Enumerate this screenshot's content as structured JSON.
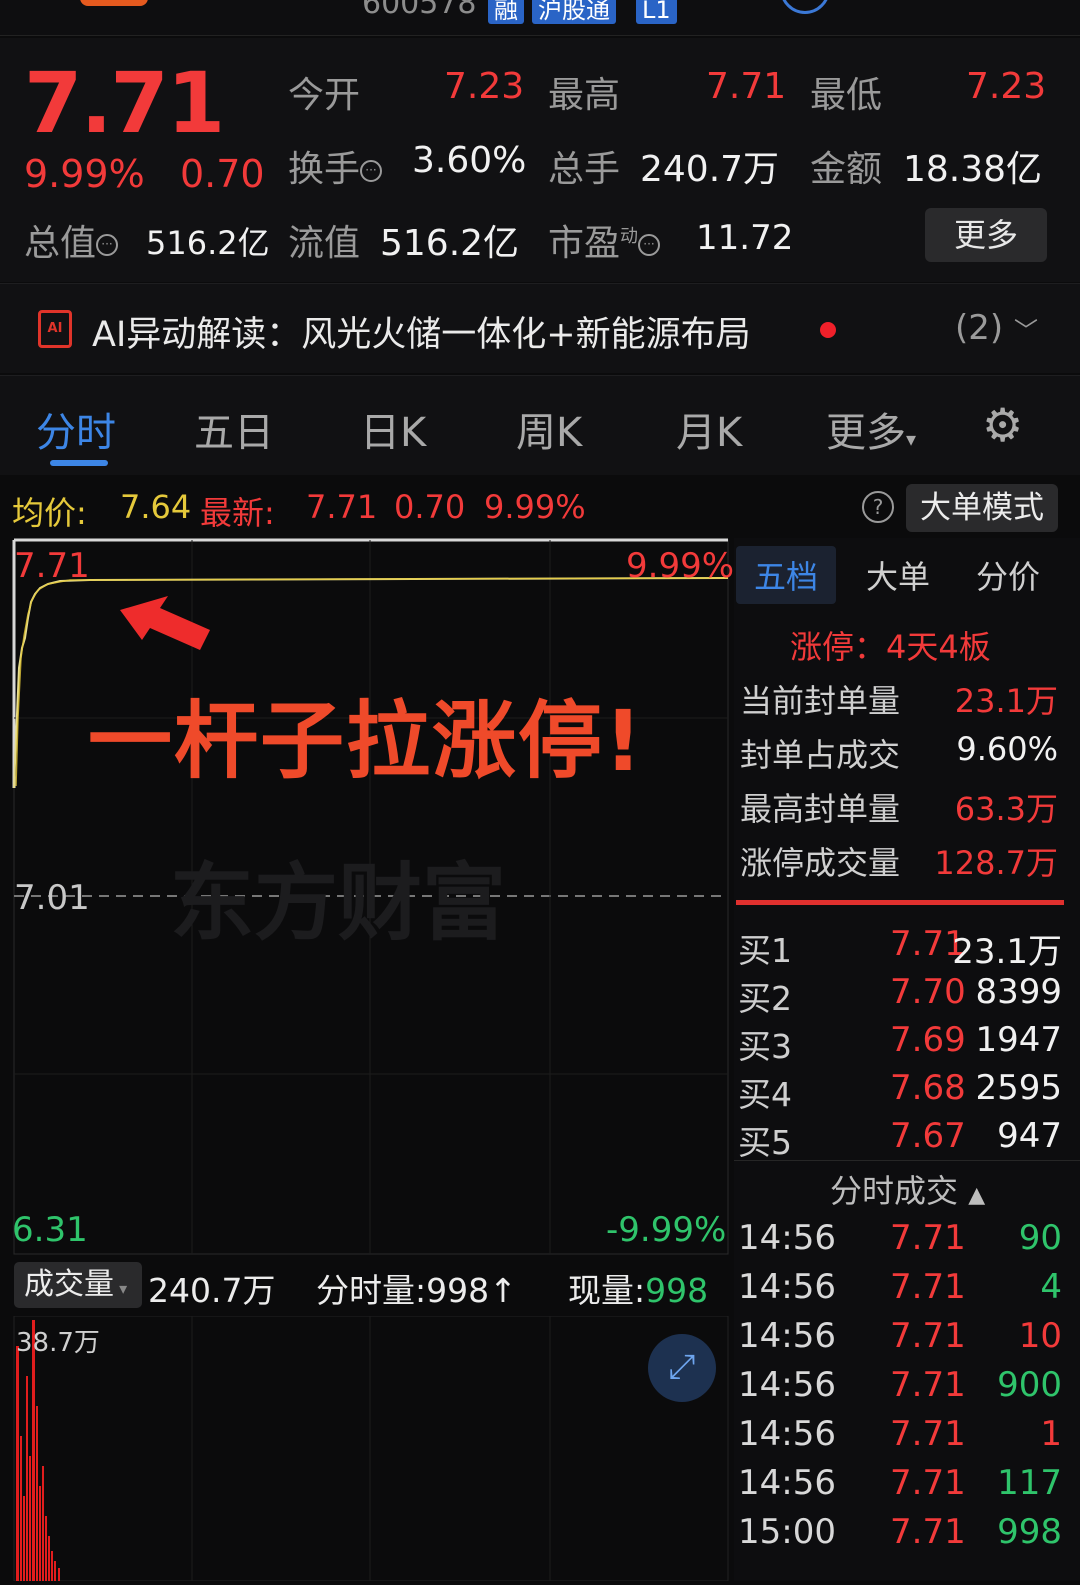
{
  "topbar": {
    "code": "600578",
    "tags": [
      "融",
      "沪股通",
      "L1"
    ]
  },
  "quote": {
    "price": "7.71",
    "change_pct": "9.99%",
    "change": "0.70",
    "open_label": "今开",
    "open": "7.23",
    "high_label": "最高",
    "high": "7.71",
    "low_label": "最低",
    "low": "7.23",
    "turnover_label": "换手",
    "turnover": "3.60%",
    "volume_label": "总手",
    "volume": "240.7万",
    "amount_label": "金额",
    "amount": "18.38亿",
    "mktcap_label": "总值",
    "mktcap": "516.2亿",
    "float_label": "流值",
    "float": "516.2亿",
    "pe_label": "市盈",
    "pe_sup": "动",
    "pe": "11.72",
    "more_label": "更多"
  },
  "ai": {
    "text": "AI异动解读：风光火储一体化+新能源布局",
    "count": "(2)"
  },
  "tabs": [
    "分时",
    "五日",
    "日K",
    "周K",
    "月K",
    "更多"
  ],
  "avgbar": {
    "avg_label": "均价:",
    "avg": "7.64",
    "latest_label": "最新:",
    "latest": "7.71",
    "chg": "0.70",
    "pct": "9.99%",
    "mode_label": "大单模式"
  },
  "chart": {
    "top_price": "7.71",
    "top_pct": "9.99%",
    "mid_price": "7.01",
    "bottom_price": "6.31",
    "bottom_pct": "-9.99%",
    "annotation": "一杆子拉涨停!",
    "watermark": "东方财富",
    "colors": {
      "price_line": "#e6dc8c",
      "up": "#f23a3a",
      "down": "#2fc46b",
      "avg": "#e5c93b"
    }
  },
  "volume": {
    "label": "成交量",
    "total": "240.7万",
    "minute_label": "分时量:",
    "minute": "998",
    "current_label": "现量:",
    "current": "998",
    "max": "38.7万"
  },
  "side": {
    "tabs": [
      "五档",
      "大单",
      "分价"
    ],
    "limit_label": "涨停：4天4板",
    "stats": [
      {
        "label": "当前封单量",
        "value": "23.1万",
        "color": "red"
      },
      {
        "label": "封单占成交",
        "value": "9.60%",
        "color": "white"
      },
      {
        "label": "最高封单量",
        "value": "63.3万",
        "color": "red"
      },
      {
        "label": "涨停成交量",
        "value": "128.7万",
        "color": "red"
      }
    ],
    "bids": [
      {
        "label": "买1",
        "price": "7.71",
        "vol": "23.1万"
      },
      {
        "label": "买2",
        "price": "7.70",
        "vol": "8399"
      },
      {
        "label": "买3",
        "price": "7.69",
        "vol": "1947"
      },
      {
        "label": "买4",
        "price": "7.68",
        "vol": "2595"
      },
      {
        "label": "买5",
        "price": "7.67",
        "vol": "947"
      }
    ],
    "ticks_label": "分时成交",
    "ticks": [
      {
        "time": "14:56",
        "price": "7.71",
        "vol": "90"
      },
      {
        "time": "14:56",
        "price": "7.71",
        "vol": "4"
      },
      {
        "time": "14:56",
        "price": "7.71",
        "vol": "10"
      },
      {
        "time": "14:56",
        "price": "7.71",
        "vol": "900"
      },
      {
        "time": "14:56",
        "price": "7.71",
        "vol": "1"
      },
      {
        "time": "14:56",
        "price": "7.71",
        "vol": "117"
      },
      {
        "time": "15:00",
        "price": "7.71",
        "vol": "998"
      }
    ]
  }
}
